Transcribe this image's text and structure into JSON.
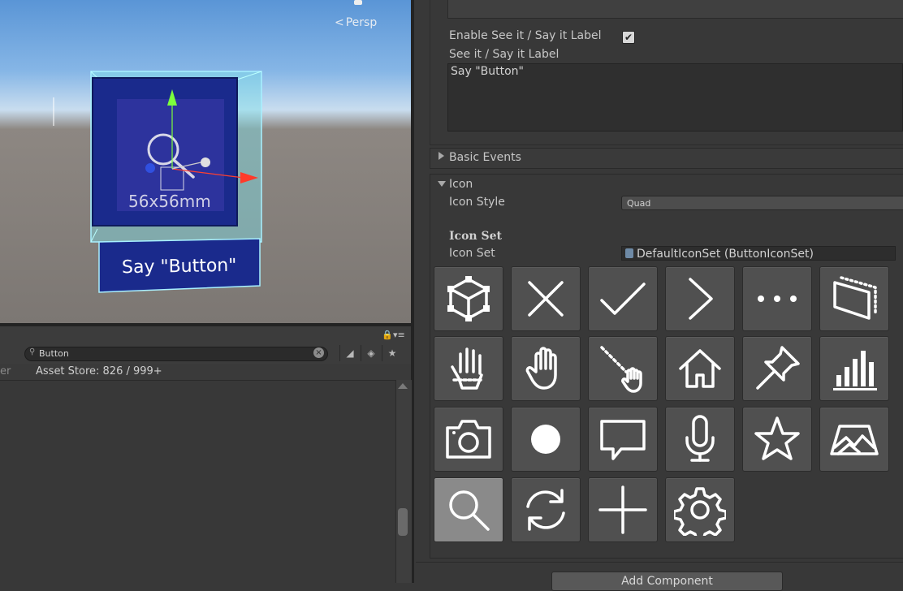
{
  "scene": {
    "view_mode": "Persp",
    "button_size_label": "56x56mm",
    "button_label": "Say \"Button\""
  },
  "project": {
    "search_value": "Button",
    "asset_store_prefix": "er",
    "asset_store_text": "Asset Store: 826 / 999+"
  },
  "inspector": {
    "enable_label": "Enable See it / Say it Label",
    "enable_checked": true,
    "see_it_label": "See it / Say it Label",
    "see_it_value": "Say \"Button\"",
    "basic_events": "Basic Events",
    "icon_section": "Icon",
    "icon_style_label": "Icon Style",
    "icon_style_value": "Quad",
    "icon_set_header": "Icon Set",
    "icon_set_label": "Icon Set",
    "icon_set_value": "DefaultIconSet (ButtonIconSet)",
    "add_component": "Add Component",
    "icons": [
      {
        "name": "cube-icon",
        "selected": false
      },
      {
        "name": "close-icon",
        "selected": false
      },
      {
        "name": "checkmark-icon",
        "selected": false
      },
      {
        "name": "chevron-right-icon",
        "selected": false
      },
      {
        "name": "more-icon",
        "selected": false
      },
      {
        "name": "slate-icon",
        "selected": false
      },
      {
        "name": "hand-joints-icon",
        "selected": false
      },
      {
        "name": "hand-icon",
        "selected": false
      },
      {
        "name": "hand-ray-icon",
        "selected": false
      },
      {
        "name": "home-icon",
        "selected": false
      },
      {
        "name": "pin-icon",
        "selected": false
      },
      {
        "name": "bar-chart-icon",
        "selected": false
      },
      {
        "name": "camera-icon",
        "selected": false
      },
      {
        "name": "record-icon",
        "selected": false
      },
      {
        "name": "speech-bubble-icon",
        "selected": false
      },
      {
        "name": "microphone-icon",
        "selected": false
      },
      {
        "name": "star-icon",
        "selected": false
      },
      {
        "name": "map-icon",
        "selected": false
      },
      {
        "name": "search-icon",
        "selected": true
      },
      {
        "name": "refresh-icon",
        "selected": false
      },
      {
        "name": "plus-icon",
        "selected": false
      },
      {
        "name": "gear-icon",
        "selected": false
      }
    ]
  }
}
